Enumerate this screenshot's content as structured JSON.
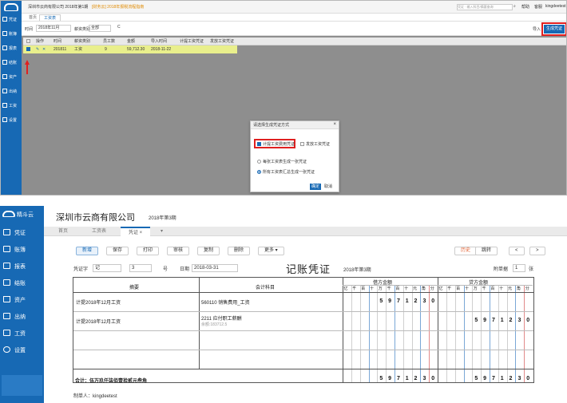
{
  "top": {
    "header": {
      "company": "深圳市云商有限公司 2018年第1期",
      "link": "[财务云] 2018年报税流程指南",
      "search_placeholder": "凭证 · 输入科目/摘要查询",
      "actions": [
        "帮助",
        "客服",
        "kingdeetest"
      ]
    },
    "sidebar": {
      "items": [
        "凭证",
        "账簿",
        "报表",
        "结账",
        "资产",
        "出纳",
        "工资",
        "设置"
      ]
    },
    "tabs": [
      "首页",
      "工资表"
    ],
    "filter": {
      "period_label": "时间",
      "period_value": "2018年11月",
      "type_label": "薪资类别",
      "type_value": "全部",
      "more": "C",
      "right_btn": "导入",
      "generate_btn": "生成凭证"
    },
    "grid": {
      "columns": [
        "",
        "操作",
        "时间",
        "薪资类别",
        "员工数",
        "金额",
        "导入时间",
        "计提工资凭证",
        "发放工资凭证"
      ],
      "row": [
        "",
        "✎",
        "201811",
        "工资",
        "9",
        "59,712.30",
        "2018-11-22",
        "",
        ""
      ]
    },
    "dialog": {
      "title": "请选择生成凭证方式",
      "check_accrue": "计提工资费用凭证",
      "check_pay": "发放工资凭证",
      "radio_each": "每张工资表生成一张凭证",
      "radio_merge": "所有工资表汇总生成一张凭证",
      "ok": "确定",
      "cancel": "取消"
    }
  },
  "bottom": {
    "logo": "精斗云",
    "sidebar": {
      "items": [
        "凭证",
        "账簿",
        "报表",
        "结账",
        "资产",
        "出纳",
        "工资",
        "设置"
      ]
    },
    "company": "深圳市云商有限公司",
    "period": "2018年第3期",
    "tabs": [
      "首页",
      "工资表",
      "凭证 ×",
      "▾"
    ],
    "toolbar": [
      "新增",
      "保存",
      "打印",
      "审核",
      "复制",
      "删除",
      "更多 ▾",
      "历史",
      "跳转",
      "<",
      ">"
    ],
    "form": {
      "word_label": "凭证字",
      "word_value": "记",
      "no": "3",
      "no_unit": "号",
      "date_label": "日期",
      "date_value": "2018-03-31",
      "attach_label": "附单据",
      "attach_value": "1",
      "attach_unit": "张"
    },
    "title": "记账凭证",
    "title_period": "2018年第3期",
    "table": {
      "col_summary": "摘要",
      "col_account": "会计科目",
      "col_debit": "借方金额",
      "col_credit": "贷方金额",
      "units": [
        "亿",
        "千",
        "百",
        "十",
        "万",
        "千",
        "百",
        "十",
        "元",
        "角",
        "分"
      ],
      "rows": [
        {
          "summary": "计提2018年12月工资",
          "account": "560110 销售费用_工资",
          "account_sub": "",
          "debit": "5971230",
          "credit": ""
        },
        {
          "summary": "计提2018年12月工资",
          "account": "2211 应付职工薪酬",
          "account_sub": "余额:183712.5",
          "debit": "",
          "credit": "5971230"
        },
        {
          "summary": "",
          "account": "",
          "account_sub": "",
          "debit": "",
          "credit": ""
        },
        {
          "summary": "",
          "account": "",
          "account_sub": "",
          "debit": "",
          "credit": ""
        }
      ],
      "total_label": "合计：伍万玖仟柒佰壹拾贰元叁角",
      "total_debit": "5971230",
      "total_credit": "5971230"
    },
    "maker": "制单人：kingdeetest"
  }
}
